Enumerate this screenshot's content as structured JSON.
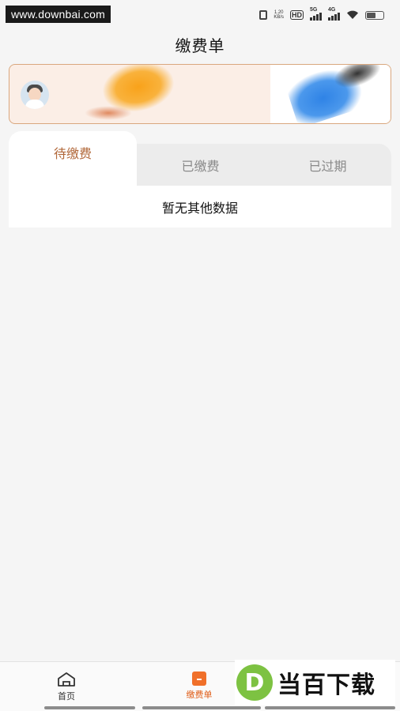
{
  "status_bar": {
    "watermark": "www.downbai.com",
    "net_speed": "1.20",
    "net_speed_unit": "KB/s",
    "hd_label": "HD",
    "signal_1": "5G",
    "signal_2": "4G",
    "icons": [
      "vibrate-icon",
      "hd-icon",
      "signal-5g-icon",
      "signal-4g-icon",
      "wifi-icon",
      "battery-icon"
    ]
  },
  "header": {
    "title": "缴费单"
  },
  "tabs": [
    {
      "label": "待缴费",
      "active": true
    },
    {
      "label": "已缴费",
      "active": false
    },
    {
      "label": "已过期",
      "active": false
    }
  ],
  "content": {
    "empty_message": "暂无其他数据"
  },
  "bottom_nav": {
    "items": [
      {
        "label": "首页",
        "icon": "home-icon",
        "active": false
      },
      {
        "label": "缴费单",
        "icon": "bill-icon",
        "active": true
      }
    ]
  },
  "watermark_bottom": {
    "letter": "D",
    "text": "当百下载"
  },
  "colors": {
    "active_tab": "#b2683a",
    "active_nav": "#e0601c",
    "card_border": "#d9a77e",
    "background": "#f5f5f5"
  }
}
